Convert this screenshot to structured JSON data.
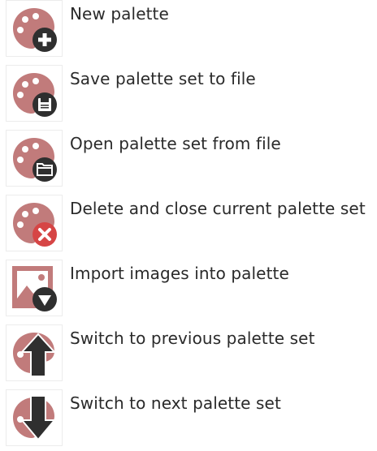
{
  "colors": {
    "palette_fill": "#c17b7b",
    "badge_fill": "#2f2f2f",
    "badge_delete_fill": "#d64545",
    "badge_glyph": "#ffffff",
    "label_text": "#2a2a2a"
  },
  "items": [
    {
      "label": "New palette",
      "icon": "palette-add-icon"
    },
    {
      "label": "Save palette set to file",
      "icon": "palette-save-icon"
    },
    {
      "label": "Open palette set from file",
      "icon": "palette-open-icon"
    },
    {
      "label": "Delete and close current palette set",
      "icon": "palette-delete-icon"
    },
    {
      "label": "Import images into palette",
      "icon": "image-import-icon"
    },
    {
      "label": "Switch to previous palette set",
      "icon": "palette-previous-icon"
    },
    {
      "label": "Switch to next palette set",
      "icon": "palette-next-icon"
    }
  ]
}
